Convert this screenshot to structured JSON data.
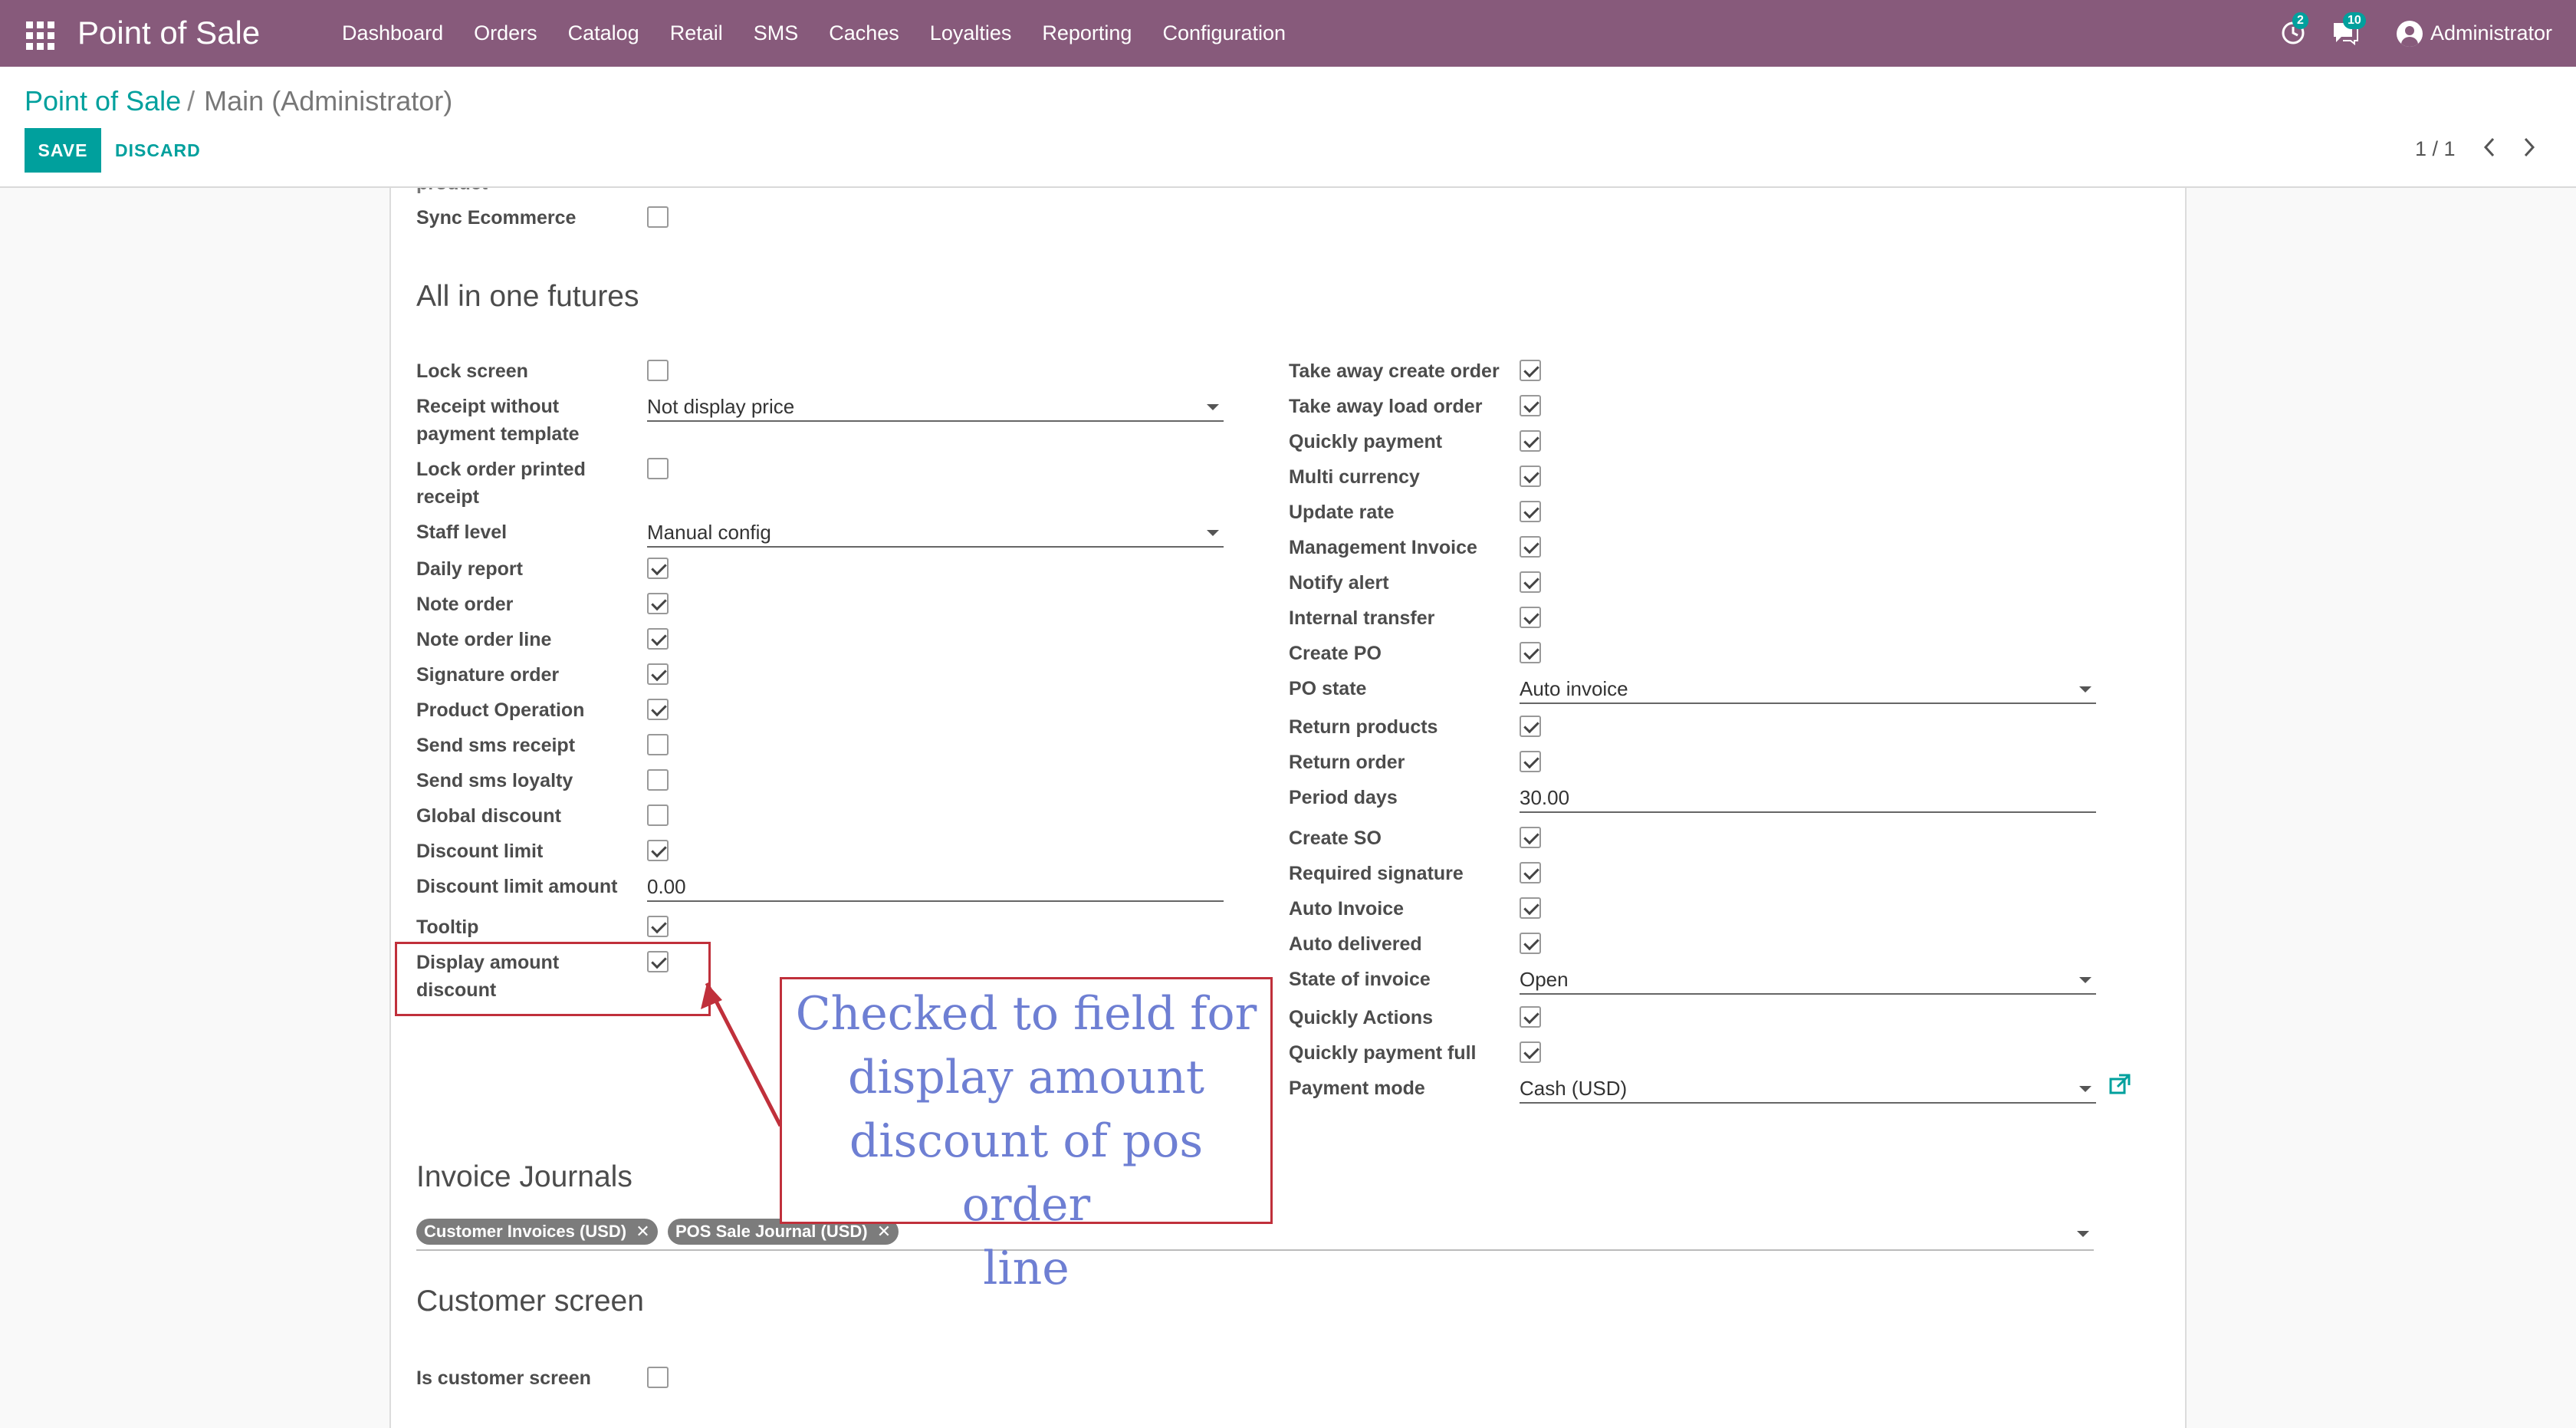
{
  "navbar": {
    "brand": "Point of Sale",
    "menu": [
      "Dashboard",
      "Orders",
      "Catalog",
      "Retail",
      "SMS",
      "Caches",
      "Loyalties",
      "Reporting",
      "Configuration"
    ],
    "activity_count": "2",
    "messages_count": "10",
    "user": "Administrator"
  },
  "breadcrumb": {
    "root": "Point of Sale",
    "separator": "/",
    "current": "Main (Administrator)"
  },
  "actions": {
    "save": "SAVE",
    "discard": "DISCARD"
  },
  "pager": {
    "value": "1 / 1"
  },
  "form": {
    "cut_label": "product",
    "sync_ecommerce": {
      "label": "Sync Ecommerce",
      "checked": false
    },
    "section_all_in_one": "All in one futures",
    "left_fields": [
      {
        "label": "Lock screen",
        "type": "checkbox",
        "checked": false
      },
      {
        "label": "Receipt without",
        "label2": "payment template",
        "type": "select",
        "value": "Not display price"
      },
      {
        "label": "Lock order printed",
        "label2": "receipt",
        "type": "checkbox",
        "checked": false
      },
      {
        "label": "Staff level",
        "type": "select",
        "value": "Manual config"
      },
      {
        "label": "Daily report",
        "type": "checkbox",
        "checked": true
      },
      {
        "label": "Note order",
        "type": "checkbox",
        "checked": true
      },
      {
        "label": "Note order line",
        "type": "checkbox",
        "checked": true
      },
      {
        "label": "Signature order",
        "type": "checkbox",
        "checked": true
      },
      {
        "label": "Product Operation",
        "type": "checkbox",
        "checked": true
      },
      {
        "label": "Send sms receipt",
        "type": "checkbox",
        "checked": false
      },
      {
        "label": "Send sms loyalty",
        "type": "checkbox",
        "checked": false
      },
      {
        "label": "Global discount",
        "type": "checkbox",
        "checked": false
      },
      {
        "label": "Discount limit",
        "type": "checkbox",
        "checked": true
      },
      {
        "label": "Discount limit amount",
        "type": "text",
        "value": "0.00"
      },
      {
        "label": "Tooltip",
        "type": "checkbox",
        "checked": true
      },
      {
        "label": "Display amount",
        "label2": "discount",
        "type": "checkbox",
        "checked": true
      }
    ],
    "right_fields": [
      {
        "label": "Take away create order",
        "type": "checkbox",
        "checked": true
      },
      {
        "label": "Take away load order",
        "type": "checkbox",
        "checked": true
      },
      {
        "label": "Quickly payment",
        "type": "checkbox",
        "checked": true
      },
      {
        "label": "Multi currency",
        "type": "checkbox",
        "checked": true
      },
      {
        "label": "Update rate",
        "type": "checkbox",
        "checked": true
      },
      {
        "label": "Management Invoice",
        "type": "checkbox",
        "checked": true
      },
      {
        "label": "Notify alert",
        "type": "checkbox",
        "checked": true
      },
      {
        "label": "Internal transfer",
        "type": "checkbox",
        "checked": true
      },
      {
        "label": "Create PO",
        "type": "checkbox",
        "checked": true
      },
      {
        "label": "PO state",
        "type": "select",
        "value": "Auto invoice"
      },
      {
        "label": "Return products",
        "type": "checkbox",
        "checked": true
      },
      {
        "label": "Return order",
        "type": "checkbox",
        "checked": true
      },
      {
        "label": "Period days",
        "type": "text",
        "value": "30.00"
      },
      {
        "label": "Create SO",
        "type": "checkbox",
        "checked": true
      },
      {
        "label": "Required signature",
        "type": "checkbox",
        "checked": true
      },
      {
        "label": "Auto Invoice",
        "type": "checkbox",
        "checked": true
      },
      {
        "label": "Auto delivered",
        "type": "checkbox",
        "checked": true
      },
      {
        "label": "State of invoice",
        "type": "select",
        "value": "Open"
      },
      {
        "label": "Quickly Actions",
        "type": "checkbox",
        "checked": true
      },
      {
        "label": "Quickly payment full",
        "type": "checkbox",
        "checked": true
      },
      {
        "label": "Payment mode",
        "type": "select",
        "value": "Cash (USD)",
        "external_link": true
      }
    ],
    "section_invoice_journals": "Invoice Journals",
    "journal_tags": [
      "Customer Invoices (USD)",
      "POS Sale Journal (USD)"
    ],
    "section_customer_screen": "Customer screen",
    "is_customer_screen": {
      "label": "Is customer screen",
      "checked": false
    }
  },
  "annotation": {
    "lines": [
      "Checked to field for",
      "display amount",
      "discount of pos order",
      "line"
    ],
    "color": "#c0303b",
    "text_color": "#6e7fd3"
  },
  "colors": {
    "navbar": "#875a7b",
    "accent": "#00a09d"
  },
  "icons": {
    "apps": "apps-grid-icon",
    "activity": "clock-icon",
    "messages": "chat-icon",
    "pager_prev": "chevron-left-icon",
    "pager_next": "chevron-right-icon",
    "external": "external-link-icon",
    "tag_remove": "close-icon"
  }
}
